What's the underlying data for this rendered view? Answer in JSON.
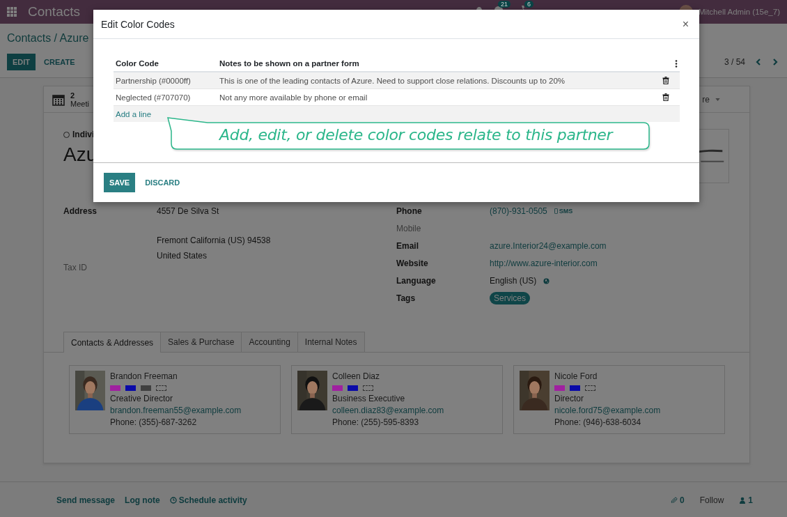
{
  "topbar": {
    "app": "Contacts",
    "chat_count": "21",
    "activity_count": "6",
    "user": "Mitchell Admin (15e_7)"
  },
  "control_panel": {
    "breadcrumb": "Contacts / Azure",
    "buttons": [
      "EDIT",
      "CREATE"
    ],
    "pager": "3 / 54"
  },
  "form": {
    "stat_button": {
      "value": "2",
      "label": "Meeti"
    },
    "more": "re",
    "company_type": "Indivi",
    "company_type_selected": false,
    "name": "Azu",
    "address": {
      "label": "Address",
      "street": "4557 De Silva St",
      "city_line": "Fremont  California (US)  94538",
      "country": "United States"
    },
    "tax_id": {
      "label": "Tax ID"
    },
    "fields": [
      {
        "label": "Phone",
        "value": "(870)-931-0505",
        "kind": "phone",
        "sms": "SMS",
        "empty": false
      },
      {
        "label": "Mobile",
        "kind": "text",
        "empty": true
      },
      {
        "label": "Email",
        "value": "azure.Interior24@example.com",
        "kind": "link",
        "empty": false
      },
      {
        "label": "Website",
        "value": "http://www.azure-interior.com",
        "kind": "link",
        "empty": false
      },
      {
        "label": "Language",
        "value": "English (US)",
        "kind": "language",
        "empty": false
      },
      {
        "label": "Tags",
        "value": "Services",
        "kind": "tag",
        "empty": false
      }
    ],
    "tabs": [
      {
        "label": "Contacts & Addresses",
        "selected": true
      },
      {
        "label": "Sales & Purchase",
        "selected": false
      },
      {
        "label": "Accounting",
        "selected": false
      },
      {
        "label": "Internal Notes",
        "selected": false
      }
    ],
    "contacts": [
      {
        "name": "Brandon Freeman",
        "tags": [
          {
            "color": "#a020a0"
          },
          {
            "color": "#0a0aa8"
          },
          {
            "color": "#404040"
          },
          {
            "kind": "empty"
          }
        ],
        "title": "Creative Director",
        "email": "brandon.freeman55@example.com",
        "phone": "Phone: (355)-687-3262"
      },
      {
        "name": "Colleen Diaz",
        "tags": [
          {
            "color": "#a020a0"
          },
          {
            "color": "#0a0aa8"
          },
          {
            "kind": "empty"
          }
        ],
        "title": "Business Executive",
        "email": "colleen.diaz83@example.com",
        "phone": "Phone: (255)-595-8393"
      },
      {
        "name": "Nicole Ford",
        "tags": [
          {
            "color": "#a020a0"
          },
          {
            "color": "#0a0aa8"
          },
          {
            "kind": "empty"
          }
        ],
        "title": "Director",
        "email": "nicole.ford75@example.com",
        "phone": "Phone: (946)-638-6034"
      }
    ]
  },
  "chatter": {
    "left": [
      "Send message",
      "Log note",
      "Schedule activity"
    ],
    "attachments": "0",
    "follow": "Follow",
    "followers": "1"
  },
  "dialog": {
    "title": "Edit Color Codes",
    "close": "×",
    "columns": [
      "Color Code",
      "Notes to be shown on a partner form"
    ],
    "rows": [
      {
        "code": "Partnership (#0000ff)",
        "notes": "This is one of the leading contacts of Azure. Need to support close relations. Discounts up to 20%"
      },
      {
        "code": "Neglected (#707070)",
        "notes": "Not any more available by phone or email"
      }
    ],
    "add_line": "Add a line",
    "callout": "Add, edit, or delete color codes relate to this partner",
    "buttons": [
      "SAVE",
      "DISCARD"
    ]
  }
}
